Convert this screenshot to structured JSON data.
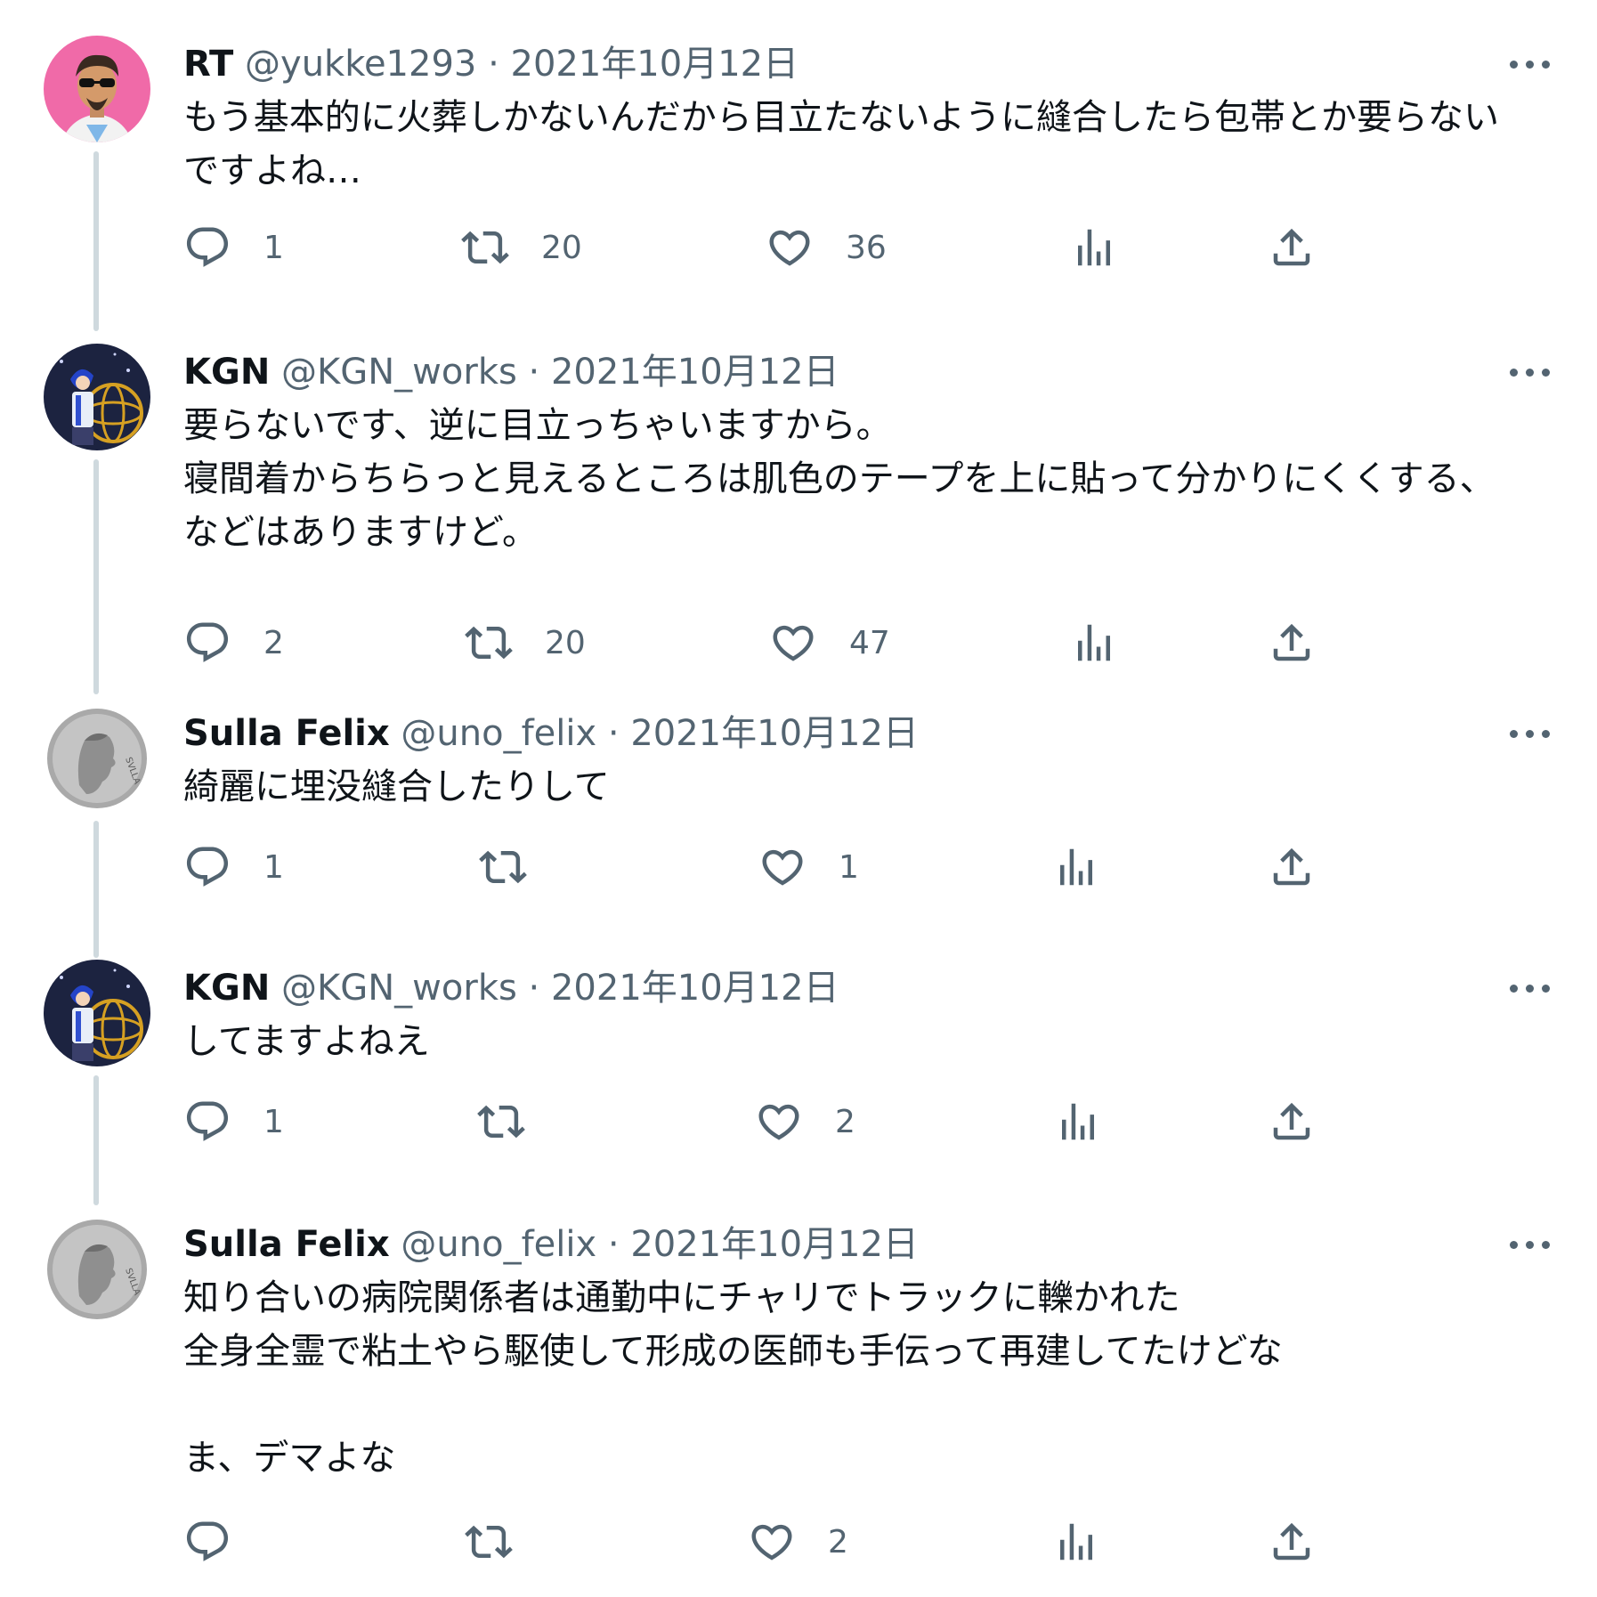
{
  "tweets": [
    {
      "name": "RT",
      "handle": "@yukke1293",
      "sep": "·",
      "date": "2021年10月12日",
      "text": "もう基本的に火葬しかないんだから目立たないように縫合したら包帯とか要らない\nですよね…",
      "reply_count": "1",
      "retweet_count": "20",
      "like_count": "36",
      "avatar_icon": "man-sunglasses-avatar-icon"
    },
    {
      "name": "KGN",
      "handle": "@KGN_works",
      "sep": "·",
      "date": "2021年10月12日",
      "text": "要らないです、逆に目立っちゃいますから。\n寝間着からちらっと見えるところは肌色のテープを上に貼って分かりにくくする、\nなどはありますけど。",
      "reply_count": "2",
      "retweet_count": "20",
      "like_count": "47",
      "avatar_icon": "anime-figure-avatar-icon"
    },
    {
      "name": "Sulla Felix",
      "handle": "@uno_felix",
      "sep": "·",
      "date": "2021年10月12日",
      "text": "綺麗に埋没縫合したりして",
      "reply_count": "1",
      "retweet_count": "",
      "like_count": "1",
      "avatar_icon": "roman-coin-avatar-icon"
    },
    {
      "name": "KGN",
      "handle": "@KGN_works",
      "sep": "·",
      "date": "2021年10月12日",
      "text": "してますよねえ",
      "reply_count": "1",
      "retweet_count": "",
      "like_count": "2",
      "avatar_icon": "anime-figure-avatar-icon"
    },
    {
      "name": "Sulla Felix",
      "handle": "@uno_felix",
      "sep": "·",
      "date": "2021年10月12日",
      "text": "知り合いの病院関係者は通勤中にチャリでトラックに轢かれた\n全身全霊で粘土やら駆使して形成の医師も手伝って再建してたけどな\n\nま、デマよな",
      "reply_count": "",
      "retweet_count": "",
      "like_count": "2",
      "avatar_icon": "roman-coin-avatar-icon"
    }
  ],
  "colors": {
    "text": "#0f1419",
    "secondary": "#536471",
    "thread_line": "#cfd9de"
  }
}
